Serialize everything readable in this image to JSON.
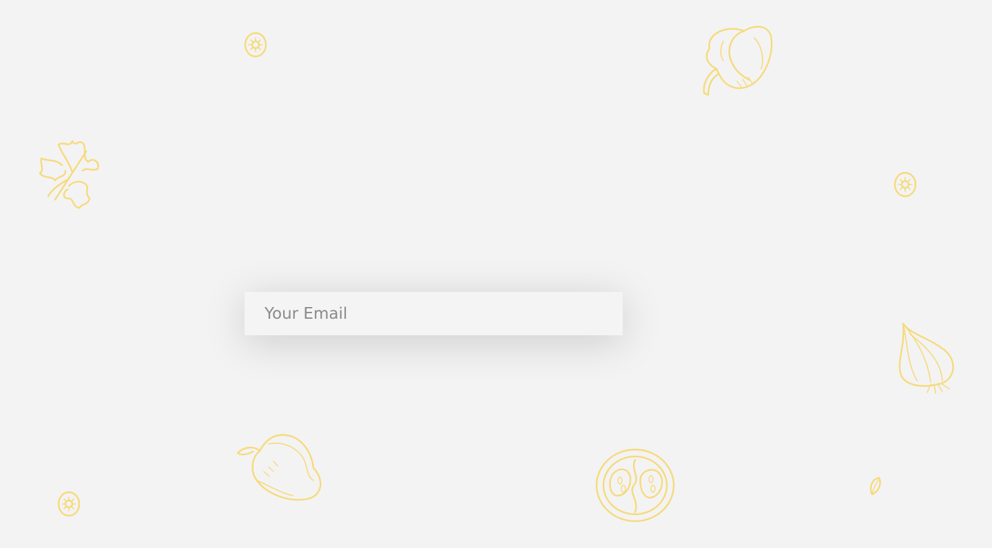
{
  "form": {
    "email_placeholder": "Your Email",
    "email_value": ""
  },
  "background": {
    "color": "#f3f3f3",
    "doodle_color": "#f6da7c",
    "doodles": [
      "slice-icon",
      "pepper-icon",
      "parsley-icon",
      "slice-icon",
      "onion-icon",
      "pepper-icon",
      "tomato-half-icon",
      "seed-icon",
      "slice-icon"
    ]
  }
}
